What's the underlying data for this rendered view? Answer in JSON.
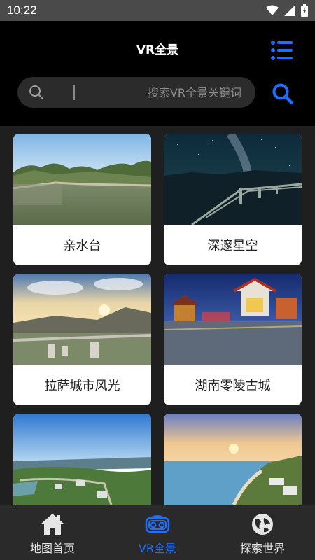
{
  "status_bar": {
    "time": "10:22"
  },
  "header": {
    "title": "VR全景"
  },
  "search": {
    "placeholder": "搜索VR全景关键词",
    "value": ""
  },
  "cards": [
    {
      "label": "亲水台"
    },
    {
      "label": "深邃星空"
    },
    {
      "label": "拉萨城市风光"
    },
    {
      "label": "湖南零陵古城"
    },
    {
      "label": ""
    },
    {
      "label": ""
    }
  ],
  "nav": [
    {
      "label": "地图首页",
      "icon": "home-icon"
    },
    {
      "label": "VR全景",
      "icon": "vr-headset-icon",
      "active": true
    },
    {
      "label": "探索世界",
      "icon": "globe-icon"
    }
  ],
  "colors": {
    "accent": "#1e6fff",
    "background": "#000000",
    "content_bg": "#1f1f1f",
    "nav_bg": "#2a2a2a"
  }
}
